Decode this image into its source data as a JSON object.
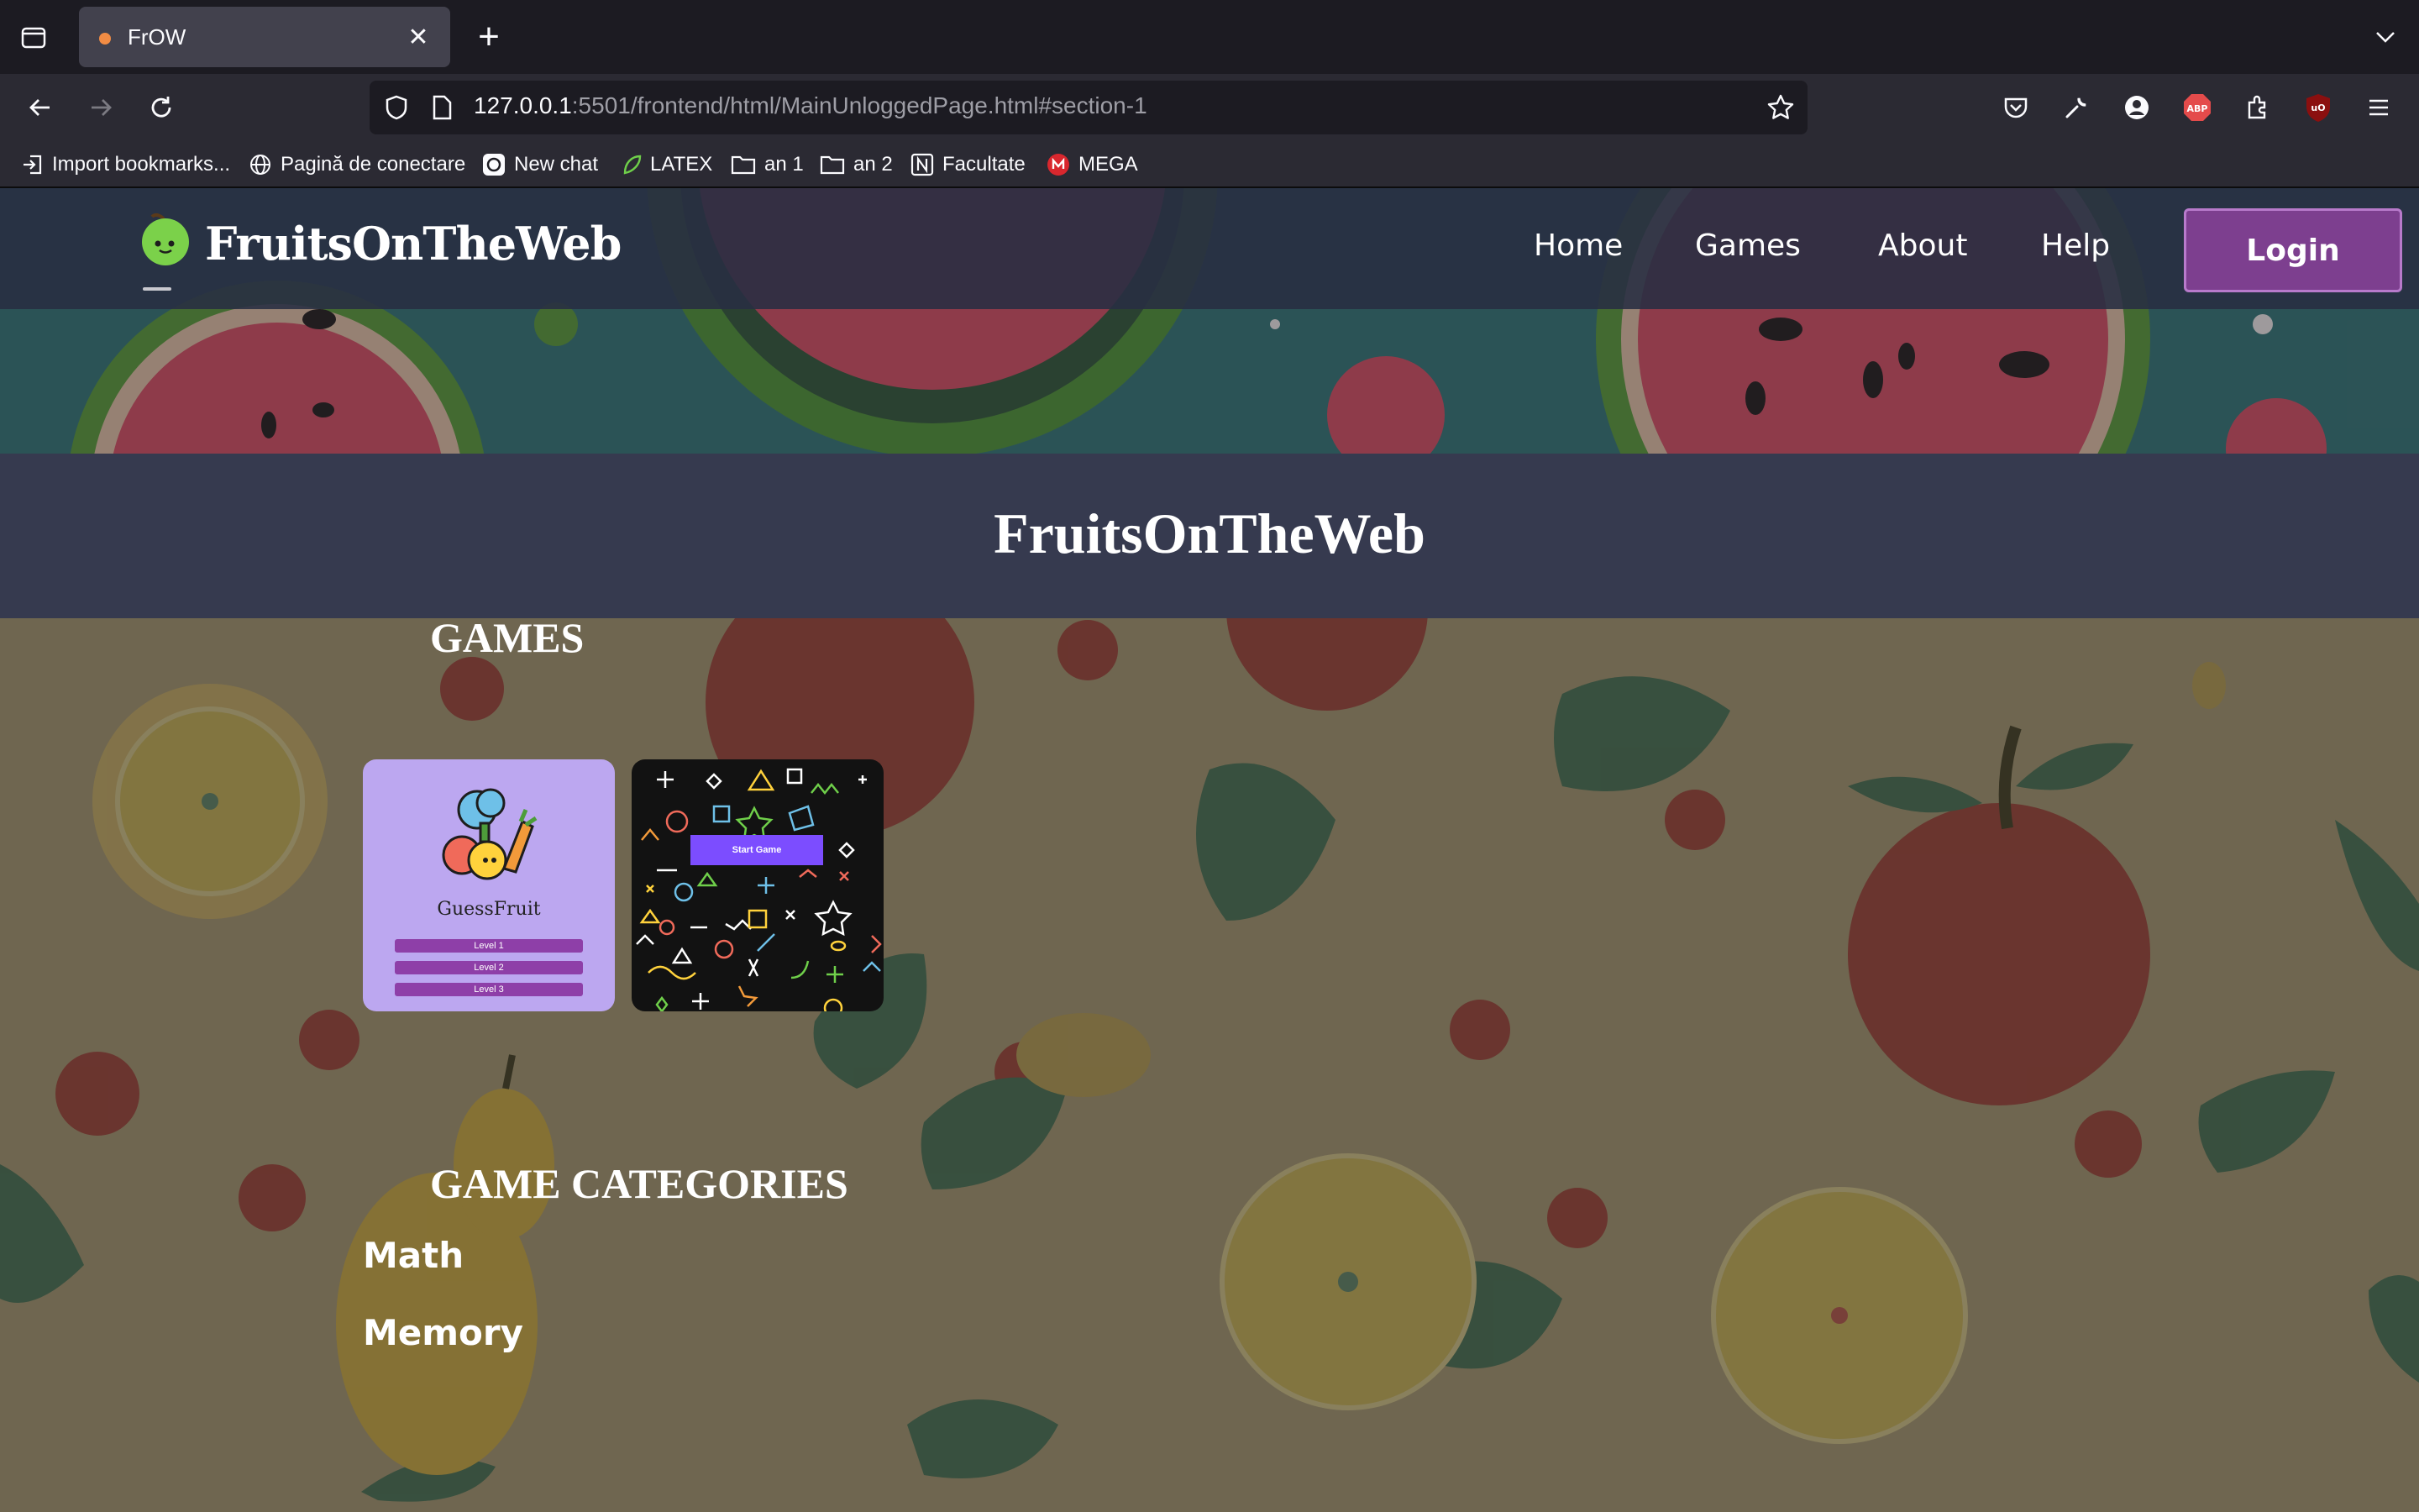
{
  "browser": {
    "tab_title": "FrOW",
    "url_host": "127.0.0.1",
    "url_rest": ":5501/frontend/html/MainUnloggedPage.html#section-1",
    "bookmarks": [
      {
        "label": "Import bookmarks...",
        "icon": "import-icon"
      },
      {
        "label": "Pagină de conectare",
        "icon": "globe-icon"
      },
      {
        "label": "New chat",
        "icon": "openai-icon"
      },
      {
        "label": "LATEX",
        "icon": "leaf-icon"
      },
      {
        "label": "an 1",
        "icon": "folder-icon"
      },
      {
        "label": "an 2",
        "icon": "folder-icon"
      },
      {
        "label": "Facultate",
        "icon": "notion-icon"
      },
      {
        "label": "MEGA",
        "icon": "mega-icon"
      }
    ],
    "extensions": {
      "abp": "ABP",
      "ublock": "uO"
    }
  },
  "header": {
    "brand": "FruitsOnTheWeb",
    "menu": [
      "Home",
      "Games",
      "About",
      "Help"
    ],
    "login_label": "Login"
  },
  "banner": {
    "title": "FruitsOnTheWeb"
  },
  "games": {
    "title": "GAMES",
    "cards": [
      {
        "name": "GuessFruit",
        "levels": [
          "Level 1",
          "Level 2",
          "Level 3"
        ]
      },
      {
        "button": "Start Game"
      }
    ]
  },
  "categories": {
    "title": "GAME CATEGORIES",
    "items": [
      "Math",
      "Memory"
    ]
  },
  "colors": {
    "accent_purple": "#7d3f8f",
    "header_bg": "#282e42",
    "banner_bg": "#363a4f",
    "card_lavender": "#bca7f0",
    "start_button": "#7c4dff"
  }
}
